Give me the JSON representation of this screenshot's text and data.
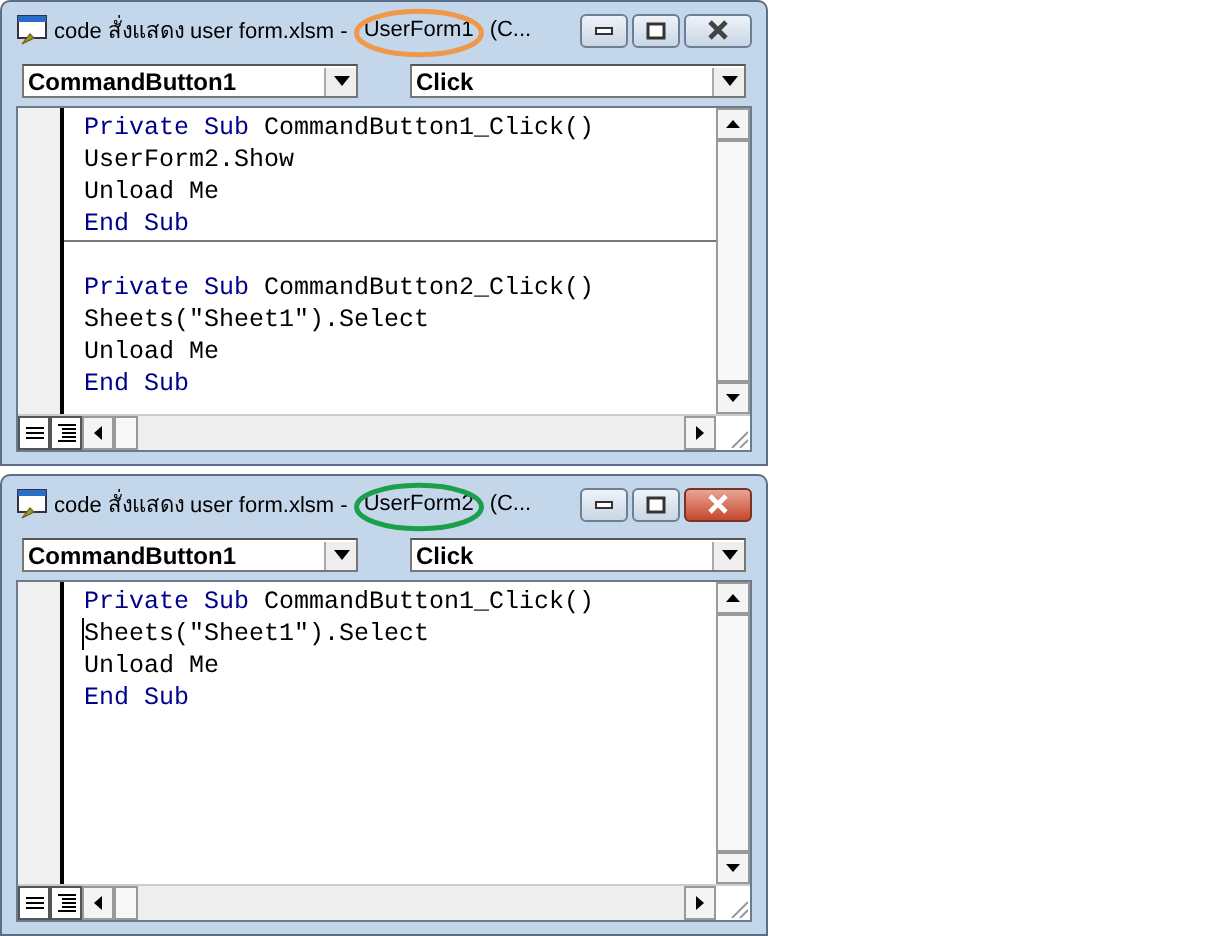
{
  "windows": [
    {
      "title_prefix": "code สั่งแสดง user form.xlsm -",
      "title_form": "UserForm1",
      "title_suffix": "(C...",
      "color": "#f0984a",
      "active": false,
      "object_dropdown": "CommandButton1",
      "procedure_dropdown": "Click",
      "procedures": [
        [
          {
            "caret": false,
            "segments": [
              {
                "kind": "keyword",
                "text": "Private Sub"
              },
              {
                "kind": "plain",
                "text": " CommandButton1_Click()"
              }
            ]
          },
          {
            "caret": false,
            "segments": [
              {
                "kind": "plain",
                "text": "UserForm2.Show"
              }
            ]
          },
          {
            "caret": false,
            "segments": [
              {
                "kind": "plain",
                "text": "Unload Me"
              }
            ]
          },
          {
            "caret": false,
            "segments": [
              {
                "kind": "keyword",
                "text": "End Sub"
              }
            ]
          }
        ],
        [
          {
            "caret": false,
            "segments": [
              {
                "kind": "keyword",
                "text": "Private Sub"
              },
              {
                "kind": "plain",
                "text": " CommandButton2_Click()"
              }
            ]
          },
          {
            "caret": false,
            "segments": [
              {
                "kind": "plain",
                "text": "Sheets(\"Sheet1\").Select"
              }
            ]
          },
          {
            "caret": false,
            "segments": [
              {
                "kind": "plain",
                "text": "Unload Me"
              }
            ]
          },
          {
            "caret": false,
            "segments": [
              {
                "kind": "keyword",
                "text": "End Sub"
              }
            ]
          }
        ]
      ]
    },
    {
      "title_prefix": "code สั่งแสดง user form.xlsm -",
      "title_form": "UserForm2",
      "title_suffix": "(C...",
      "color": "#1aa04a",
      "active": true,
      "object_dropdown": "CommandButton1",
      "procedure_dropdown": "Click",
      "procedures": [
        [
          {
            "caret": false,
            "segments": [
              {
                "kind": "keyword",
                "text": "Private Sub"
              },
              {
                "kind": "plain",
                "text": " CommandButton1_Click()"
              }
            ]
          },
          {
            "caret": true,
            "segments": [
              {
                "kind": "plain",
                "text": "Sheets(\"Sheet1\").Select"
              }
            ]
          },
          {
            "caret": false,
            "segments": [
              {
                "kind": "plain",
                "text": "Unload Me"
              }
            ]
          },
          {
            "caret": false,
            "segments": [
              {
                "kind": "keyword",
                "text": "End Sub"
              }
            ]
          }
        ]
      ]
    }
  ]
}
